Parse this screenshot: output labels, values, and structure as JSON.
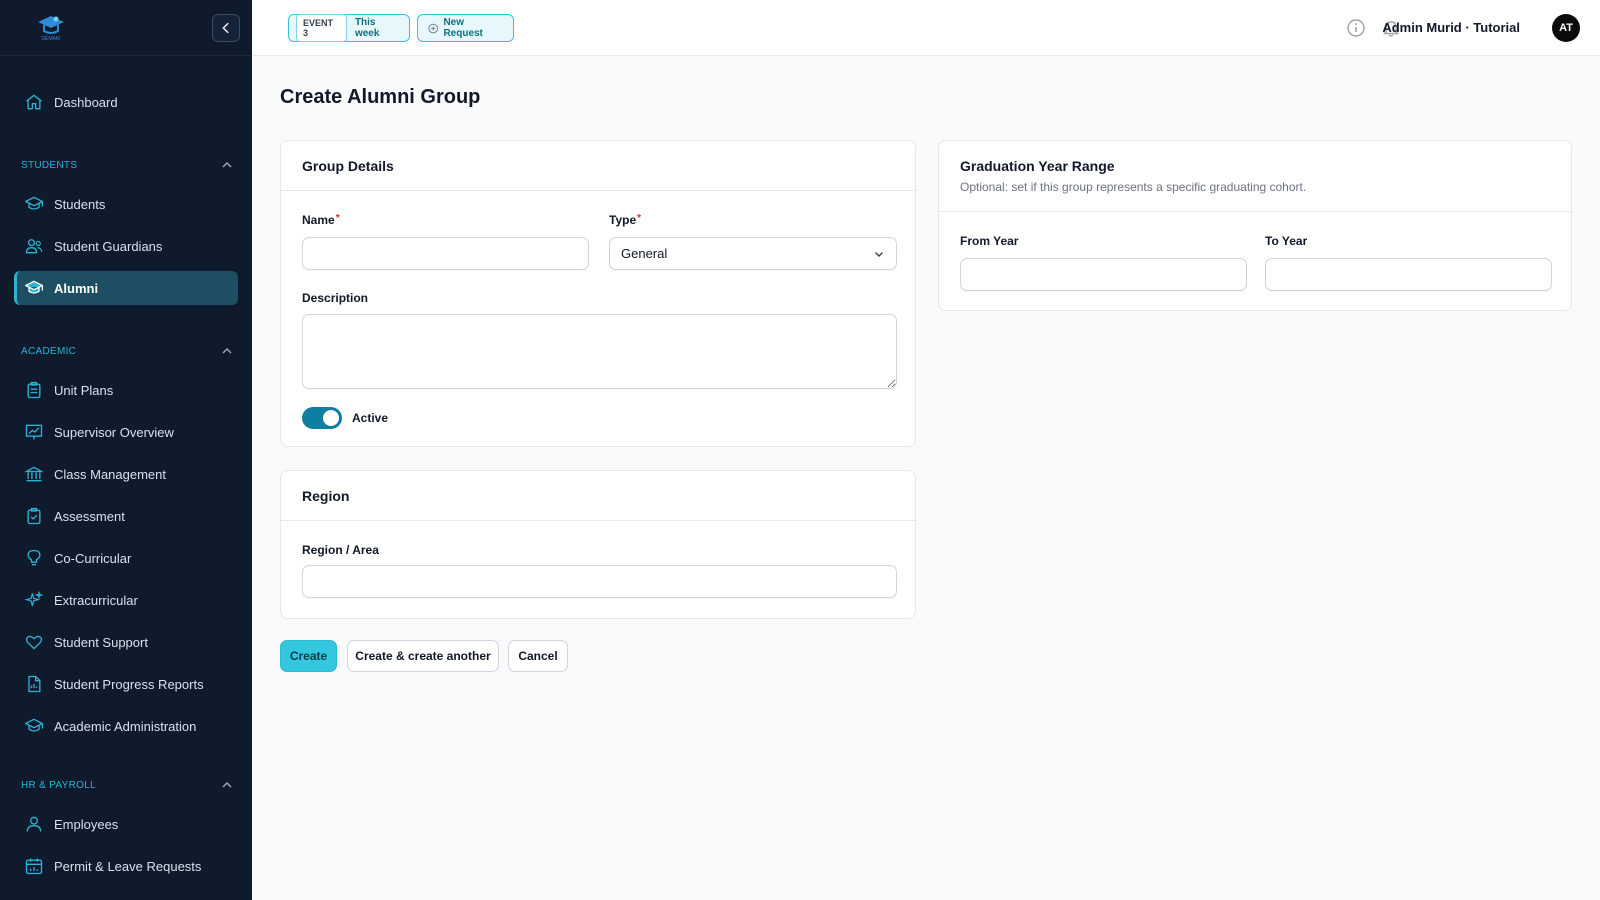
{
  "sidebar": {
    "logo_text": "DEMAKI",
    "items": {
      "dashboard": "Dashboard",
      "students_section": "STUDENTS",
      "students": "Students",
      "guardians": "Student Guardians",
      "alumni": "Alumni",
      "academic_section": "ACADEMIC",
      "unit_plans": "Unit Plans",
      "supervisor": "Supervisor Overview",
      "class_mgmt": "Class Management",
      "assessment": "Assessment",
      "co_curricular": "Co-Curricular",
      "extracurricular": "Extracurricular",
      "student_support": "Student Support",
      "progress_reports": "Student Progress Reports",
      "academic_admin": "Academic Administration",
      "hr_section": "HR & PAYROLL",
      "employees": "Employees",
      "permit": "Permit & Leave Requests"
    }
  },
  "topbar": {
    "event_tag": "EVENT 3",
    "event_label": "This week",
    "new_request": "New Request",
    "user_name": "Admin Murid · Tutorial",
    "avatar_initials": "AT"
  },
  "page": {
    "title": "Create Alumni Group"
  },
  "group_details": {
    "title": "Group Details",
    "name_label": "Name",
    "type_label": "Type",
    "type_value": "General",
    "description_label": "Description",
    "active_label": "Active",
    "required_mark": "*"
  },
  "region": {
    "title": "Region",
    "field_label": "Region / Area"
  },
  "graduation": {
    "title": "Graduation Year Range",
    "subtitle": "Optional: set if this group represents a specific graduating cohort.",
    "from_label": "From Year",
    "to_label": "To Year"
  },
  "actions": {
    "create": "Create",
    "create_another": "Create & create another",
    "cancel": "Cancel"
  },
  "colors": {
    "sidebar_bg": "#0f1b2d",
    "accent": "#2bb3d4",
    "primary_button": "#34c8e0",
    "toggle_on": "#0e7fa0"
  }
}
